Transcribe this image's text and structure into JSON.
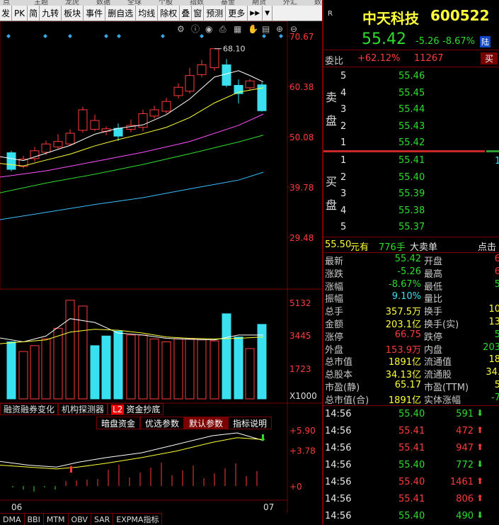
{
  "top_strip": [
    "点",
    "主题",
    "龙虎",
    "数据",
    "全球",
    "个股",
    "指数",
    "基金",
    "期货",
    "外汇",
    "数据"
  ],
  "toolbar": {
    "items": [
      "发",
      "PK",
      "简",
      "九转",
      "板块",
      "事件",
      "删自选",
      "均线",
      "除权",
      "叠",
      "窗",
      "预测",
      "更多"
    ],
    "expand_icon": "fast-forward-icon",
    "dropdown_icon": "caret-down-icon"
  },
  "chart_tools": [
    "gear-icon",
    "info-icon",
    "eye-icon",
    "print-icon",
    "grid-icon",
    "hand-icon",
    "calendar-icon",
    "zoom-in-icon",
    "zoom-out-icon"
  ],
  "price_axis": [
    "70.67",
    "60.38",
    "50.08",
    "39.78",
    "29.48"
  ],
  "high_marker": "68.10",
  "vol_axis": [
    "5132",
    "3445",
    "1723",
    "X1000"
  ],
  "indicator_tabs": {
    "left_truncated": "融资融券变化",
    "items": [
      "机构探测器",
      "资金抄底"
    ],
    "l2_badge": "L2"
  },
  "param_buttons": [
    "暗盘资金",
    "优选参数",
    "默认参数",
    "指标说明"
  ],
  "ind_axis": [
    "+5.90",
    "+3.78",
    "+0"
  ],
  "date_labels": [
    "06",
    "07"
  ],
  "bottom_tabs": [
    "DMA",
    "BBI",
    "MTM",
    "OBV",
    "SAR",
    "EXPMA指标"
  ],
  "colors": {
    "up": "#ff3b3b",
    "down": "#38e0f0",
    "ma5": "#ffffff",
    "ma10": "#ffff38",
    "ma20": "#ff50ff",
    "ma30": "#2fdc2f",
    "ma60": "#38c0ff",
    "border": "#7a0000"
  },
  "quote": {
    "corner": "R",
    "name": "中天科技",
    "code": "600522",
    "price": "55.42",
    "change": "-5.26",
    "change_pct": "-8.67%",
    "market_badge": "陆",
    "weibi_label": "委比",
    "weibi": "+62.12%",
    "weicha": "11267",
    "sell_button": "买"
  },
  "ask": {
    "side_label": [
      "卖",
      "盘"
    ],
    "levels": [
      {
        "n": "5",
        "price": "55.46"
      },
      {
        "n": "4",
        "price": "55.45"
      },
      {
        "n": "3",
        "price": "55.44"
      },
      {
        "n": "2",
        "price": "55.43"
      },
      {
        "n": "1",
        "price": "55.42"
      }
    ]
  },
  "bid": {
    "side_label": [
      "买",
      "盘"
    ],
    "right_edge": "1",
    "levels": [
      {
        "n": "1",
        "price": "55.41"
      },
      {
        "n": "2",
        "price": "55.40"
      },
      {
        "n": "3",
        "price": "55.39"
      },
      {
        "n": "4",
        "price": "55.38"
      },
      {
        "n": "5",
        "price": "55.37"
      }
    ]
  },
  "big_order": {
    "price": "55.50",
    "unit": "元有",
    "volume": "776手",
    "label": "大卖单",
    "tail": "点击"
  },
  "stats": [
    {
      "l": "最新",
      "v": "55.42",
      "vc": "green",
      "r": "开盘",
      "rv": "6",
      "rvc": "red"
    },
    {
      "l": "涨跌",
      "v": "-5.26",
      "vc": "green",
      "r": "最高",
      "rv": "6",
      "rvc": "red"
    },
    {
      "l": "涨幅",
      "v": "-8.67%",
      "vc": "green",
      "r": "最低",
      "rv": "5",
      "rvc": "green"
    },
    {
      "l": "振幅",
      "v": "9.10%",
      "vc": "cyan",
      "r": "量比",
      "rv": "",
      "rvc": "white"
    },
    {
      "l": "总手",
      "v": "357.5万",
      "vc": "yellow",
      "r": "换手",
      "rv": "10",
      "rvc": "yellow"
    },
    {
      "l": "金额",
      "v": "203.1亿",
      "vc": "yellow",
      "r": "换手(实)",
      "rv": "13",
      "rvc": "yellow"
    },
    {
      "l": "涨停",
      "v": "66.75",
      "vc": "red",
      "r": "跌停",
      "rv": "5",
      "rvc": "green"
    },
    {
      "l": "外盘",
      "v": "153.9万",
      "vc": "red",
      "r": "内盘",
      "rv": "203",
      "rvc": "green"
    },
    {
      "l": "总市值",
      "v": "1891亿",
      "vc": "yellow",
      "r": "流通值",
      "rv": "18",
      "rvc": "yellow"
    },
    {
      "l": "总股本",
      "v": "34.13亿",
      "vc": "yellow",
      "r": "流通股",
      "rv": "34.",
      "rvc": "yellow"
    },
    {
      "l": "市盈(静)",
      "v": "65.17",
      "vc": "yellow",
      "r": "市盈(TTM)",
      "rv": "5",
      "rvc": "yellow"
    },
    {
      "l": "总市值(合)",
      "v": "1891亿",
      "vc": "yellow",
      "r": "实体涨幅",
      "rv": "-7",
      "rvc": "green"
    }
  ],
  "ticks": [
    {
      "t": "14:56",
      "p": "55.40",
      "v": "591",
      "dir": "down"
    },
    {
      "t": "14:56",
      "p": "55.41",
      "v": "472",
      "dir": "up"
    },
    {
      "t": "14:56",
      "p": "55.41",
      "v": "947",
      "dir": "up"
    },
    {
      "t": "14:56",
      "p": "55.40",
      "v": "772",
      "dir": "down"
    },
    {
      "t": "14:56",
      "p": "55.40",
      "v": "1461",
      "dir": "up"
    },
    {
      "t": "14:56",
      "p": "55.41",
      "v": "806",
      "dir": "up"
    },
    {
      "t": "14:56",
      "p": "55.40",
      "v": "490",
      "dir": "down"
    }
  ]
}
